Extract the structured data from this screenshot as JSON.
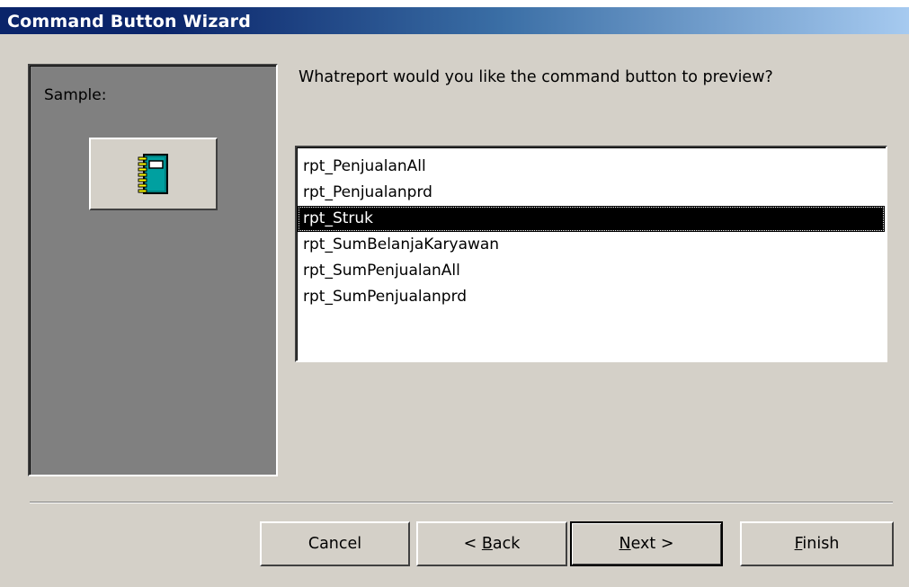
{
  "window": {
    "title": "Command Button Wizard"
  },
  "sample": {
    "label": "Sample:",
    "icon": "report-notebook-icon"
  },
  "question": "Whatreport would you like the command button to preview?",
  "report_list": {
    "items": [
      "rpt_PenjualanAll",
      "rpt_Penjualanprd",
      "rpt_Struk",
      "rpt_SumBelanjaKaryawan",
      "rpt_SumPenjualanAll",
      "rpt_SumPenjualanprd"
    ],
    "selected": "rpt_Struk"
  },
  "buttons": {
    "cancel": "Cancel",
    "back_prefix": "< ",
    "back_mnemonic": "B",
    "back_rest": "ack",
    "next_mnemonic": "N",
    "next_rest": "ext >",
    "finish_mnemonic": "F",
    "finish_rest": "inish"
  },
  "colors": {
    "title_bar_start": "#0a246a",
    "title_bar_end": "#a6caf0",
    "dialog_face": "#d4d0c8",
    "sample_panel": "#808080",
    "selection": "#000000"
  }
}
